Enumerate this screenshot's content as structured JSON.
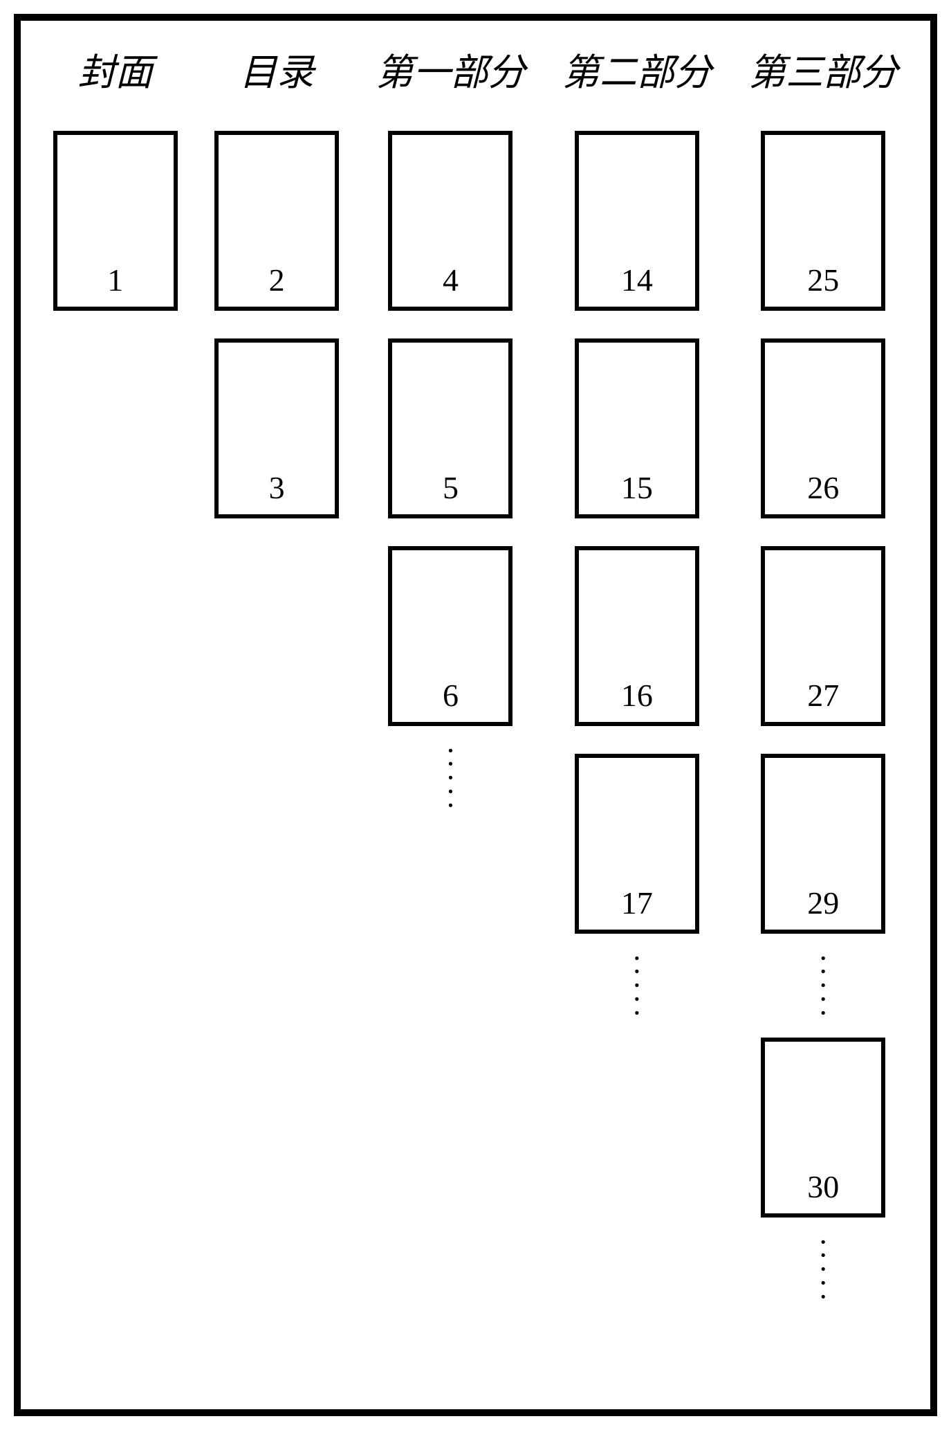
{
  "columns": [
    {
      "header": "封面",
      "items": [
        {
          "type": "page",
          "number": "1"
        }
      ]
    },
    {
      "header": "目录",
      "items": [
        {
          "type": "page",
          "number": "2"
        },
        {
          "type": "page",
          "number": "3"
        }
      ]
    },
    {
      "header": "第一部分",
      "items": [
        {
          "type": "page",
          "number": "4"
        },
        {
          "type": "page",
          "number": "5"
        },
        {
          "type": "page",
          "number": "6"
        },
        {
          "type": "vdots"
        }
      ]
    },
    {
      "header": "第二部分",
      "items": [
        {
          "type": "page",
          "number": "14"
        },
        {
          "type": "page",
          "number": "15"
        },
        {
          "type": "page",
          "number": "16"
        },
        {
          "type": "page",
          "number": "17"
        },
        {
          "type": "vdots"
        }
      ]
    },
    {
      "header": "第三部分",
      "items": [
        {
          "type": "page",
          "number": "25"
        },
        {
          "type": "page",
          "number": "26"
        },
        {
          "type": "page",
          "number": "27"
        },
        {
          "type": "page",
          "number": "29"
        },
        {
          "type": "vdots"
        },
        {
          "type": "page",
          "number": "30"
        },
        {
          "type": "vdots"
        }
      ]
    }
  ]
}
